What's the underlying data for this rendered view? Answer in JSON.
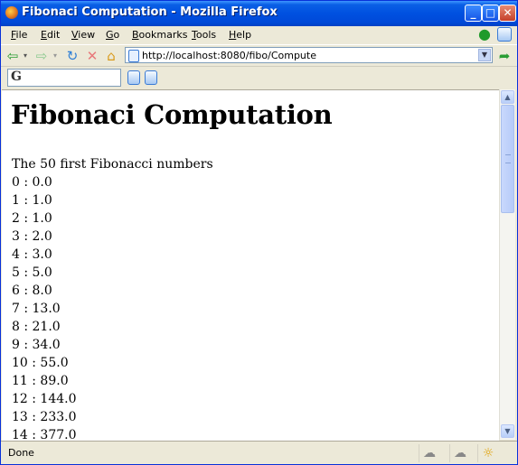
{
  "window": {
    "title": "Fibonaci Computation - Mozilla Firefox"
  },
  "menu": [
    {
      "label": "File",
      "key": "F",
      "rest": "ile"
    },
    {
      "label": "Edit",
      "key": "E",
      "rest": "dit"
    },
    {
      "label": "View",
      "key": "V",
      "rest": "iew"
    },
    {
      "label": "Go",
      "key": "G",
      "rest": "o"
    },
    {
      "label": "Bookmarks",
      "key": "B",
      "rest": "ookmarks"
    },
    {
      "label": "Tools",
      "key": "T",
      "rest": "ools"
    },
    {
      "label": "Help",
      "key": "H",
      "rest": "elp"
    }
  ],
  "nav": {
    "url": "http://localhost:8080/fibo/Compute"
  },
  "search": {
    "engine_glyph": "G"
  },
  "page": {
    "heading": "Fibonaci Computation",
    "subtitle": "The 50 first Fibonacci numbers",
    "fib_lines": [
      "0 : 0.0",
      "1 : 1.0",
      "2 : 1.0",
      "3 : 2.0",
      "4 : 3.0",
      "5 : 5.0",
      "6 : 8.0",
      "7 : 13.0",
      "8 : 21.0",
      "9 : 34.0",
      "10 : 55.0",
      "11 : 89.0",
      "12 : 144.0",
      "13 : 233.0",
      "14 : 377.0"
    ]
  },
  "status": {
    "text": "Done"
  },
  "colors": {
    "titlebar": "#0050e0",
    "chrome": "#ece9d8",
    "accent": "#3a7bd5"
  }
}
